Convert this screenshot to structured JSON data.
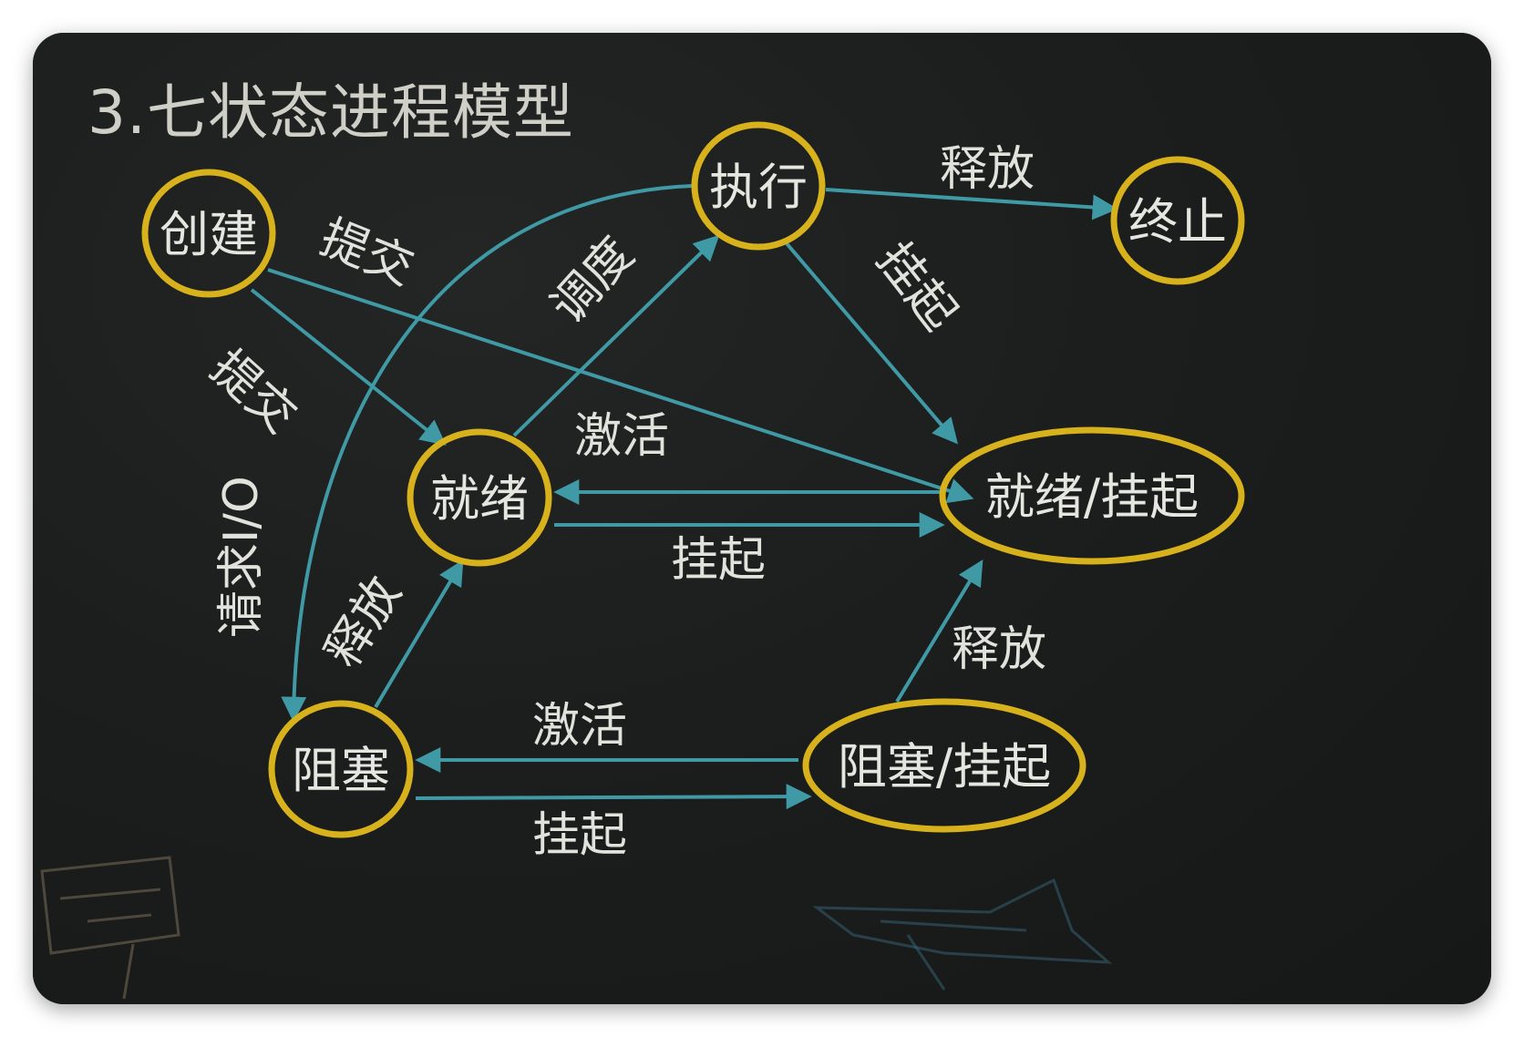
{
  "title": "3.七状态进程模型",
  "nodes": {
    "create": "创建",
    "execute": "执行",
    "terminate": "终止",
    "ready": "就绪",
    "ready_suspend": "就绪/挂起",
    "blocked": "阻塞",
    "blocked_suspend": "阻塞/挂起"
  },
  "edges": {
    "create_to_ready_suspend": "提交",
    "create_to_ready": "提交",
    "ready_to_execute": "调度",
    "execute_to_terminate": "释放",
    "execute_to_ready_suspend": "挂起",
    "ready_suspend_to_ready": "激活",
    "ready_to_ready_suspend": "挂起",
    "execute_to_blocked": "请求I/O",
    "blocked_to_ready": "释放",
    "blocked_suspend_to_ready_suspend": "释放",
    "blocked_suspend_to_blocked": "激活",
    "blocked_to_blocked_suspend": "挂起"
  },
  "colors": {
    "node_ring": "#d8b21c",
    "edge": "#3f9aa6",
    "board": "#1a1c1c",
    "text": "#e6e6e0"
  }
}
